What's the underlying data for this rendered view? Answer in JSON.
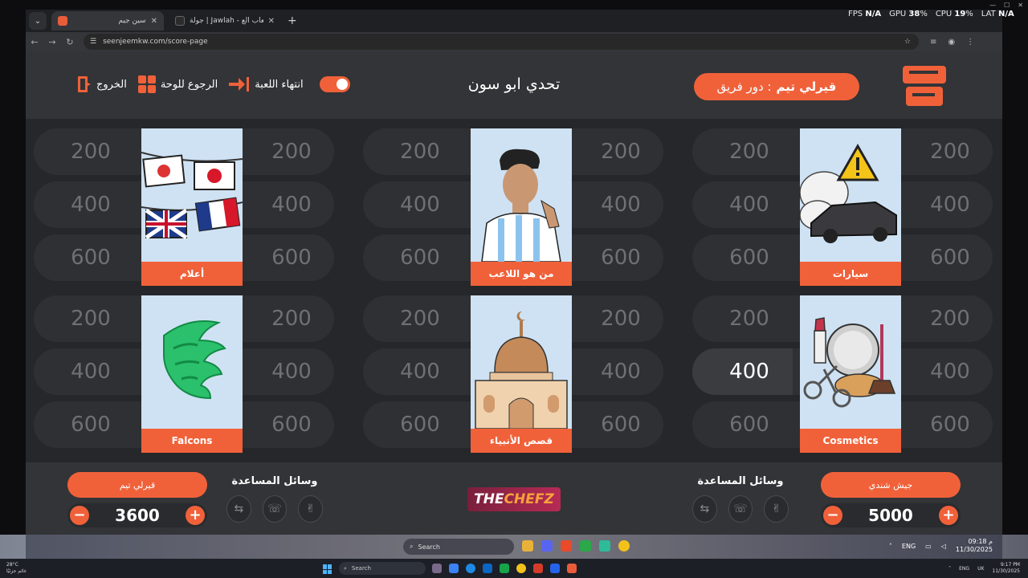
{
  "browser": {
    "tabs": [
      {
        "title": "سين جيم",
        "active": true
      },
      {
        "title": "جولة | Jawlah - منصة الألعاب الع",
        "active": false
      }
    ],
    "url": "seenjeemkw.com/score-page"
  },
  "perf": {
    "fps_label": "FPS",
    "fps_value": "N/A",
    "gpu_label": "GPU",
    "gpu_value": "38",
    "cpu_label": "CPU",
    "cpu_value": "19",
    "lat_label": "LAT",
    "lat_value": "N/A",
    "percent": "%"
  },
  "header": {
    "logo_text": "سين جيم",
    "turn_label": "دور فريق :",
    "turn_team": "قيرلي تيم",
    "game_title": "تحدي ابو سون",
    "end_game": "انتهاء اللعبة",
    "back_to_board": "الرجوع للوحة",
    "exit": "الخروج"
  },
  "board": {
    "points": [
      "200",
      "400",
      "600"
    ],
    "categories": [
      {
        "name": "سيارات",
        "image": "car-warning-image"
      },
      {
        "name": "من هو اللاعب",
        "image": "footballer-image"
      },
      {
        "name": "أعلام",
        "image": "flags-image"
      },
      {
        "name": "Cosmetics",
        "image": "cosmetics-image"
      },
      {
        "name": "قصص الأنبياء",
        "image": "mosque-image"
      },
      {
        "name": "Falcons",
        "image": "falcons-logo-image"
      }
    ]
  },
  "footer": {
    "team_right": {
      "name": "جيش شندي",
      "score": "5000"
    },
    "team_left": {
      "name": "قيرلي تيم",
      "score": "3600"
    },
    "aids_title": "وسائل المساعدة",
    "sponsor_the": "THE",
    "sponsor_chefz": "CHEFZ",
    "minus": "−",
    "plus": "+"
  },
  "inner_taskbar": {
    "search": "Search",
    "lang": "ENG",
    "time": "09:18 م",
    "date": "11/30/2025"
  },
  "taskbar": {
    "weather_temp": "28°C",
    "weather_text": "غائم جزئيًا",
    "search": "Search",
    "lang": "ENG",
    "region": "UK",
    "time": "9:17 PM",
    "date": "11/30/2025"
  },
  "colors": {
    "accent": "#f0613a",
    "panel": "#333437",
    "board": "#26272a"
  }
}
